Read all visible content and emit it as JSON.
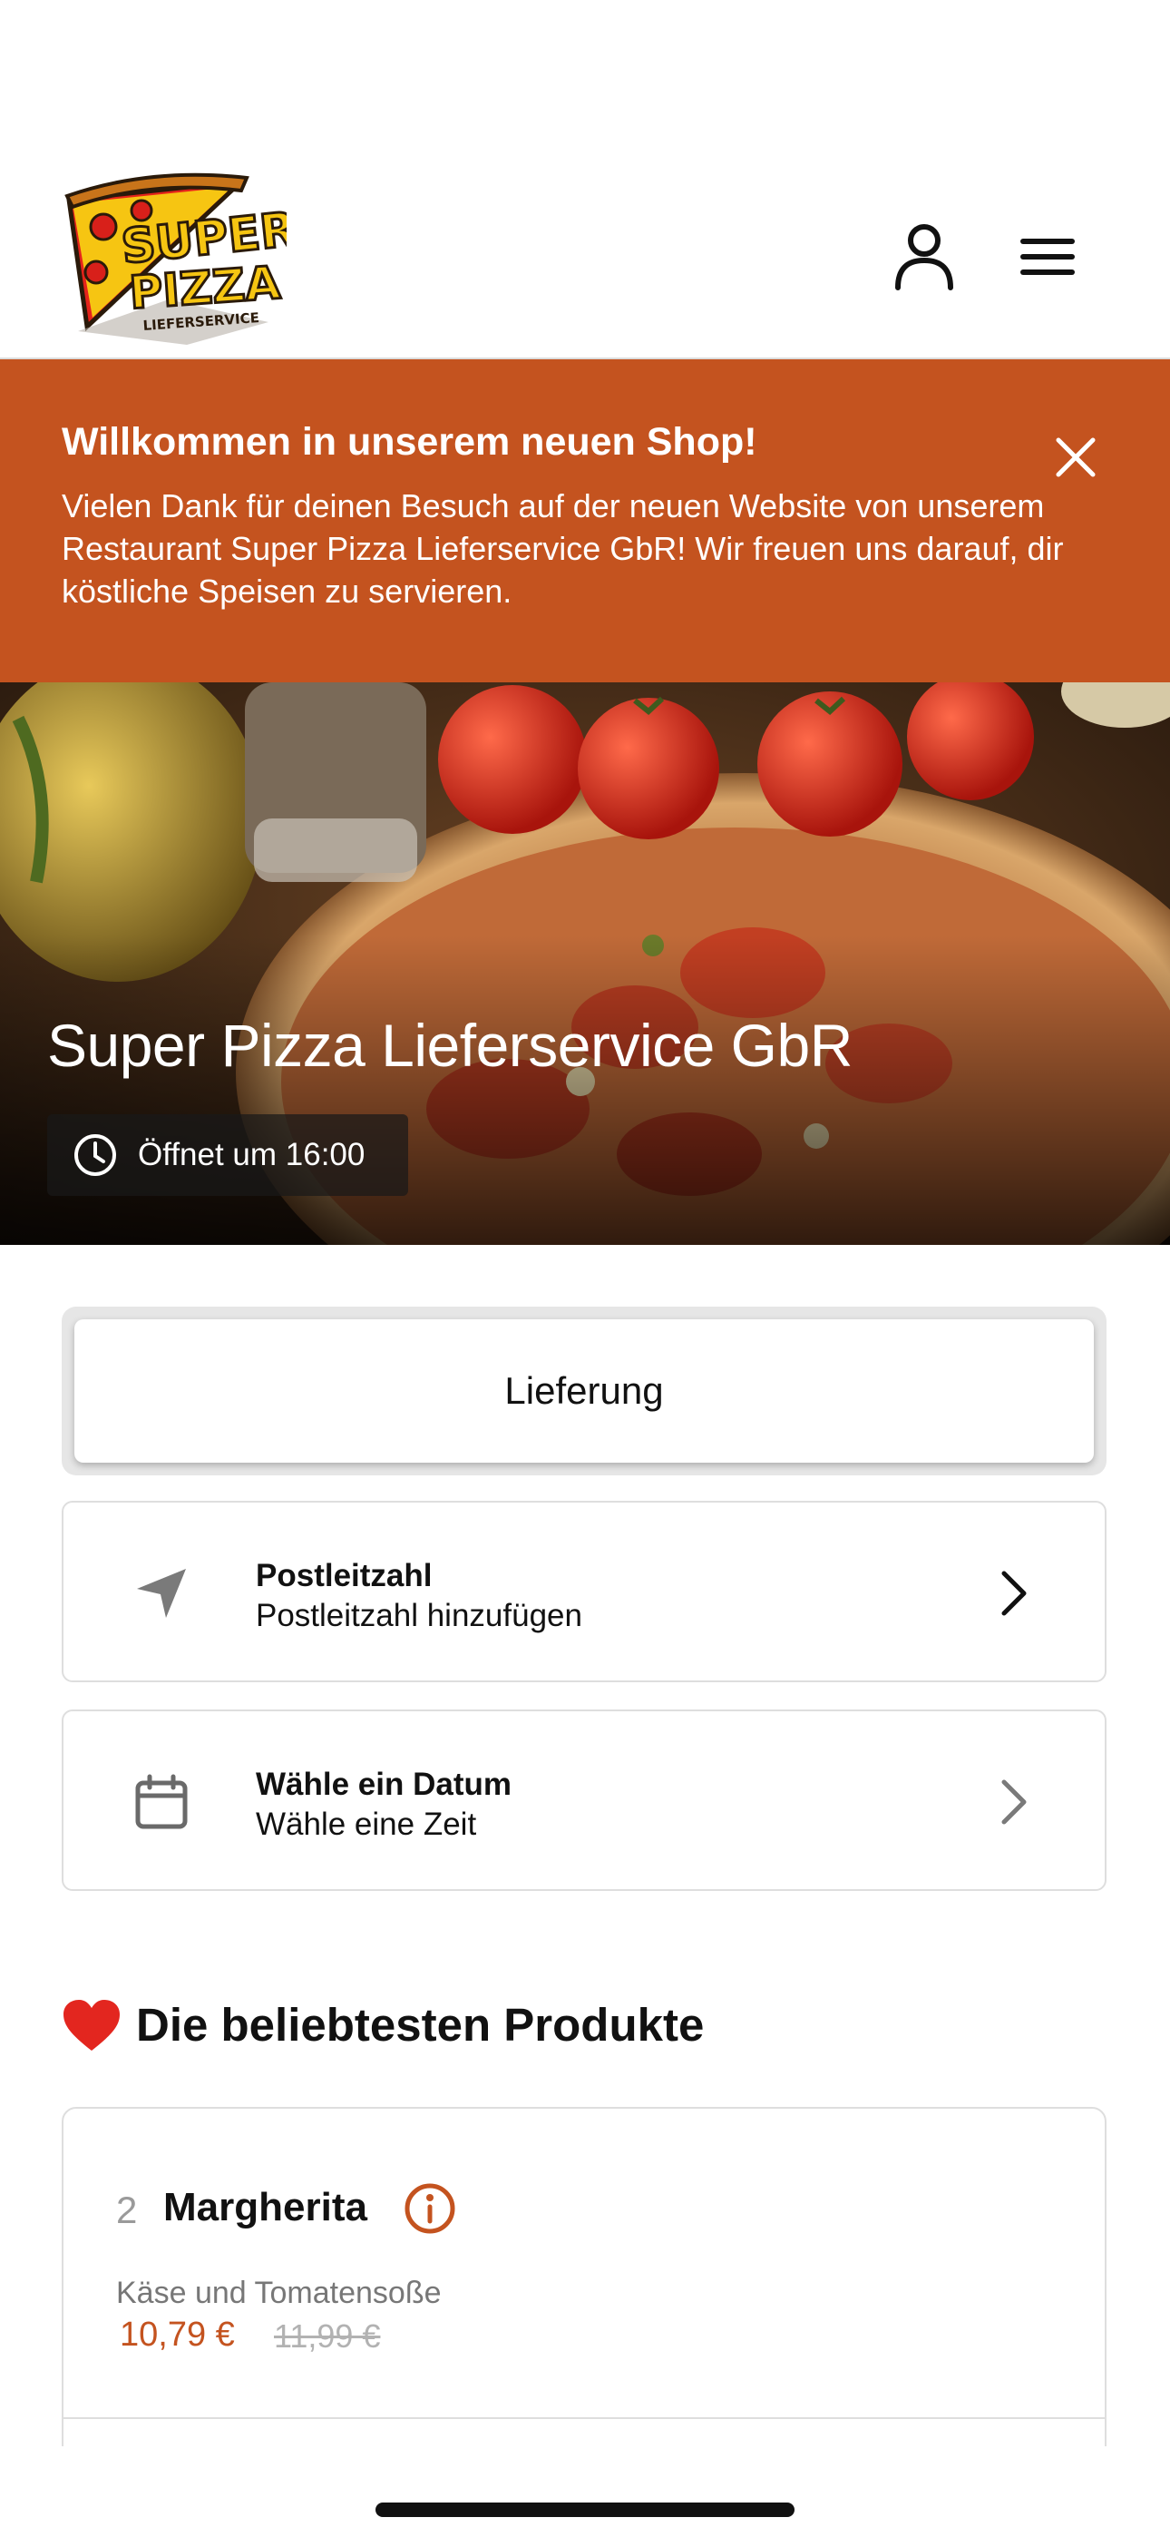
{
  "header": {
    "logo": {
      "line1": "SUPER",
      "line2": "PIZZA",
      "line3": "LIEFERSERVICE"
    },
    "user_icon": "user-icon",
    "menu_icon": "hamburger-menu-icon"
  },
  "banner": {
    "title": "Willkommen in unserem neuen Shop!",
    "text": "Vielen Dank für deinen Besuch auf der neuen Website von unserem Restaurant Super Pizza Lieferservice GbR! Wir freuen uns darauf, dir köstliche Speisen zu servieren.",
    "close_icon": "close-icon",
    "background": "#c4531f"
  },
  "hero": {
    "title": "Super Pizza Lieferservice GbR",
    "hours": "Öffnet um 16:00",
    "clock_icon": "clock-icon"
  },
  "order_mode": {
    "selected": "Lieferung"
  },
  "options": {
    "zip": {
      "title": "Postleitzahl",
      "subtitle": "Postleitzahl hinzufügen",
      "icon": "location-arrow-icon"
    },
    "date": {
      "title": "Wähle ein Datum",
      "subtitle": "Wähle eine Zeit",
      "icon": "calendar-icon"
    }
  },
  "popular": {
    "heading": "Die beliebtesten Produkte",
    "heading_icon": "heart-icon",
    "products": [
      {
        "qty": "2",
        "name": "Margherita",
        "description": "Käse und Tomatensoße",
        "price": "10,79 €",
        "old_price": "11,99 €"
      }
    ]
  },
  "colors": {
    "accent": "#c4531f",
    "text": "#111111",
    "muted": "#777777"
  }
}
